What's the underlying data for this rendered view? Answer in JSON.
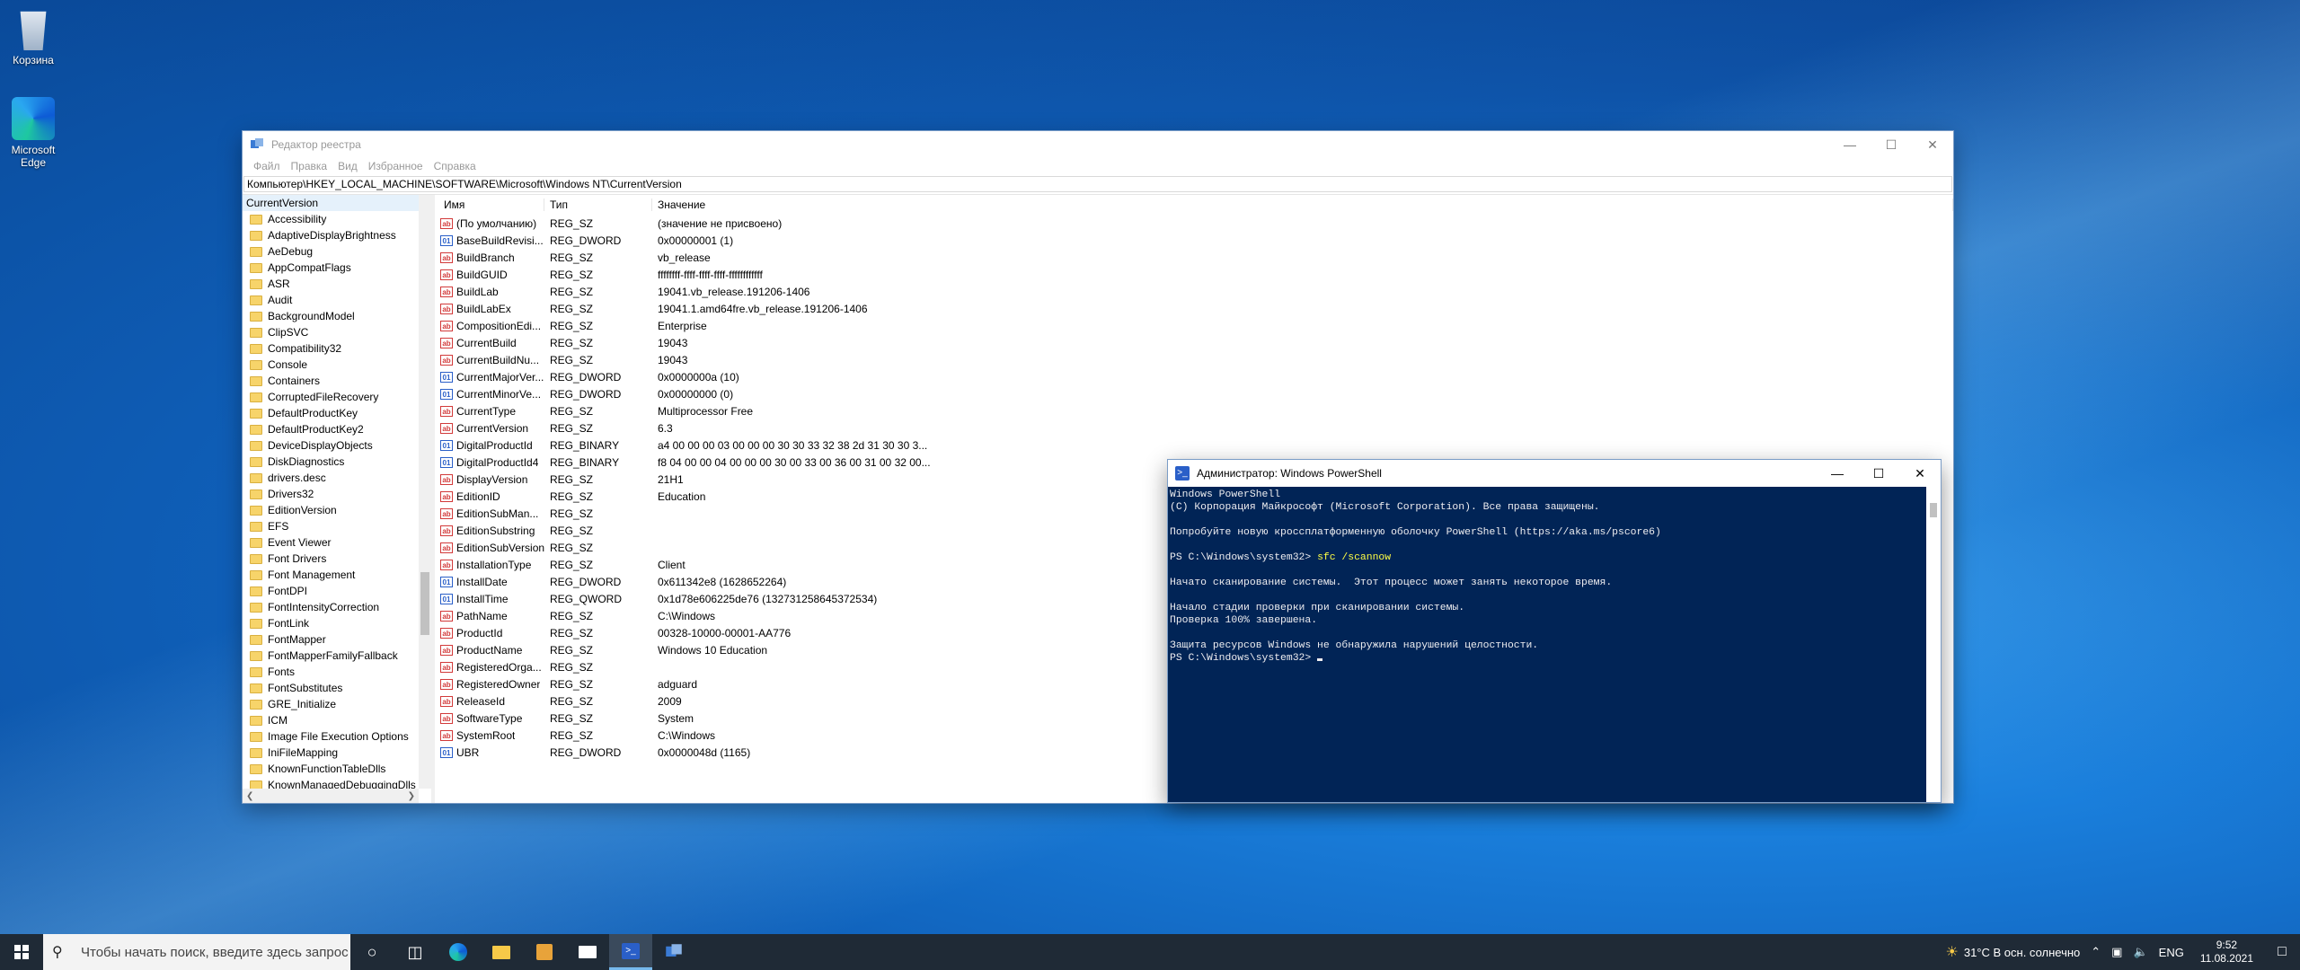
{
  "desktop": {
    "icons": [
      {
        "label": "Корзина",
        "icon": "recycle-bin-icon"
      },
      {
        "label": "Microsoft Edge",
        "icon": "edge-icon"
      }
    ]
  },
  "regedit": {
    "title": "Редактор реестра",
    "menu": [
      "Файл",
      "Правка",
      "Вид",
      "Избранное",
      "Справка"
    ],
    "address": "Компьютер\\HKEY_LOCAL_MACHINE\\SOFTWARE\\Microsoft\\Windows NT\\CurrentVersion",
    "tree_root": "CurrentVersion",
    "tree_items": [
      "Accessibility",
      "AdaptiveDisplayBrightness",
      "AeDebug",
      "AppCompatFlags",
      "ASR",
      "Audit",
      "BackgroundModel",
      "ClipSVC",
      "Compatibility32",
      "Console",
      "Containers",
      "CorruptedFileRecovery",
      "DefaultProductKey",
      "DefaultProductKey2",
      "DeviceDisplayObjects",
      "DiskDiagnostics",
      "drivers.desc",
      "Drivers32",
      "EditionVersion",
      "EFS",
      "Event Viewer",
      "Font Drivers",
      "Font Management",
      "FontDPI",
      "FontIntensityCorrection",
      "FontLink",
      "FontMapper",
      "FontMapperFamilyFallback",
      "Fonts",
      "FontSubstitutes",
      "GRE_Initialize",
      "ICM",
      "Image File Execution Options",
      "IniFileMapping",
      "KnownFunctionTableDlls",
      "KnownManagedDebuggingDlls"
    ],
    "columns": {
      "name": "Имя",
      "type": "Тип",
      "data": "Значение"
    },
    "values": [
      {
        "name": "(По умолчанию)",
        "type": "REG_SZ",
        "data": "(значение не присвоено)",
        "icon": "sz"
      },
      {
        "name": "BaseBuildRevisi...",
        "type": "REG_DWORD",
        "data": "0x00000001 (1)",
        "icon": "bin"
      },
      {
        "name": "BuildBranch",
        "type": "REG_SZ",
        "data": "vb_release",
        "icon": "sz"
      },
      {
        "name": "BuildGUID",
        "type": "REG_SZ",
        "data": "ffffffff-ffff-ffff-ffff-ffffffffffff",
        "icon": "sz"
      },
      {
        "name": "BuildLab",
        "type": "REG_SZ",
        "data": "19041.vb_release.191206-1406",
        "icon": "sz"
      },
      {
        "name": "BuildLabEx",
        "type": "REG_SZ",
        "data": "19041.1.amd64fre.vb_release.191206-1406",
        "icon": "sz"
      },
      {
        "name": "CompositionEdi...",
        "type": "REG_SZ",
        "data": "Enterprise",
        "icon": "sz"
      },
      {
        "name": "CurrentBuild",
        "type": "REG_SZ",
        "data": "19043",
        "icon": "sz"
      },
      {
        "name": "CurrentBuildNu...",
        "type": "REG_SZ",
        "data": "19043",
        "icon": "sz"
      },
      {
        "name": "CurrentMajorVer...",
        "type": "REG_DWORD",
        "data": "0x0000000a (10)",
        "icon": "bin"
      },
      {
        "name": "CurrentMinorVe...",
        "type": "REG_DWORD",
        "data": "0x00000000 (0)",
        "icon": "bin"
      },
      {
        "name": "CurrentType",
        "type": "REG_SZ",
        "data": "Multiprocessor Free",
        "icon": "sz"
      },
      {
        "name": "CurrentVersion",
        "type": "REG_SZ",
        "data": "6.3",
        "icon": "sz"
      },
      {
        "name": "DigitalProductId",
        "type": "REG_BINARY",
        "data": "a4 00 00 00 03 00 00 00 30 30 33 32 38 2d 31 30 30 3...",
        "icon": "bin"
      },
      {
        "name": "DigitalProductId4",
        "type": "REG_BINARY",
        "data": "f8 04 00 00 04 00 00 00 30 00 33 00 36 00 31 00 32 00...",
        "icon": "bin"
      },
      {
        "name": "DisplayVersion",
        "type": "REG_SZ",
        "data": "21H1",
        "icon": "sz"
      },
      {
        "name": "EditionID",
        "type": "REG_SZ",
        "data": "Education",
        "icon": "sz"
      },
      {
        "name": "EditionSubMan...",
        "type": "REG_SZ",
        "data": "",
        "icon": "sz"
      },
      {
        "name": "EditionSubstring",
        "type": "REG_SZ",
        "data": "",
        "icon": "sz"
      },
      {
        "name": "EditionSubVersion",
        "type": "REG_SZ",
        "data": "",
        "icon": "sz"
      },
      {
        "name": "InstallationType",
        "type": "REG_SZ",
        "data": "Client",
        "icon": "sz"
      },
      {
        "name": "InstallDate",
        "type": "REG_DWORD",
        "data": "0x611342e8 (1628652264)",
        "icon": "bin"
      },
      {
        "name": "InstallTime",
        "type": "REG_QWORD",
        "data": "0x1d78e606225de76 (132731258645372534)",
        "icon": "bin"
      },
      {
        "name": "PathName",
        "type": "REG_SZ",
        "data": "C:\\Windows",
        "icon": "sz"
      },
      {
        "name": "ProductId",
        "type": "REG_SZ",
        "data": "00328-10000-00001-AA776",
        "icon": "sz"
      },
      {
        "name": "ProductName",
        "type": "REG_SZ",
        "data": "Windows 10 Education",
        "icon": "sz"
      },
      {
        "name": "RegisteredOrga...",
        "type": "REG_SZ",
        "data": "",
        "icon": "sz"
      },
      {
        "name": "RegisteredOwner",
        "type": "REG_SZ",
        "data": "adguard",
        "icon": "sz"
      },
      {
        "name": "ReleaseId",
        "type": "REG_SZ",
        "data": "2009",
        "icon": "sz"
      },
      {
        "name": "SoftwareType",
        "type": "REG_SZ",
        "data": "System",
        "icon": "sz"
      },
      {
        "name": "SystemRoot",
        "type": "REG_SZ",
        "data": "C:\\Windows",
        "icon": "sz"
      },
      {
        "name": "UBR",
        "type": "REG_DWORD",
        "data": "0x0000048d (1165)",
        "icon": "bin"
      }
    ]
  },
  "powershell": {
    "title": "Администратор: Windows PowerShell",
    "lines": [
      {
        "text": "Windows PowerShell"
      },
      {
        "text": "(C) Корпорация Майкрософт (Microsoft Corporation). Все права защищены."
      },
      {
        "text": ""
      },
      {
        "text": "Попробуйте новую кроссплатформенную оболочку PowerShell (https://aka.ms/pscore6)"
      },
      {
        "text": ""
      },
      {
        "text": "PS C:\\Windows\\system32> ",
        "cmd": "sfc /scannow"
      },
      {
        "text": ""
      },
      {
        "text": "Начато сканирование системы.  Этот процесс может занять некоторое время."
      },
      {
        "text": ""
      },
      {
        "text": "Начало стадии проверки при сканировании системы."
      },
      {
        "text": "Проверка 100% завершена."
      },
      {
        "text": ""
      },
      {
        "text": "Защита ресурсов Windows не обнаружила нарушений целостности."
      },
      {
        "text": "PS C:\\Windows\\system32> ",
        "cursor": true
      }
    ]
  },
  "taskbar": {
    "search_placeholder": "Чтобы начать поиск, введите здесь запрос",
    "weather": "31°C  В осн. солнечно",
    "language": "ENG",
    "time": "9:52",
    "date": "11.08.2021"
  },
  "colors": {
    "ps_background": "#012456",
    "ps_command": "#fefe44",
    "taskbar": "#1f2a36"
  }
}
